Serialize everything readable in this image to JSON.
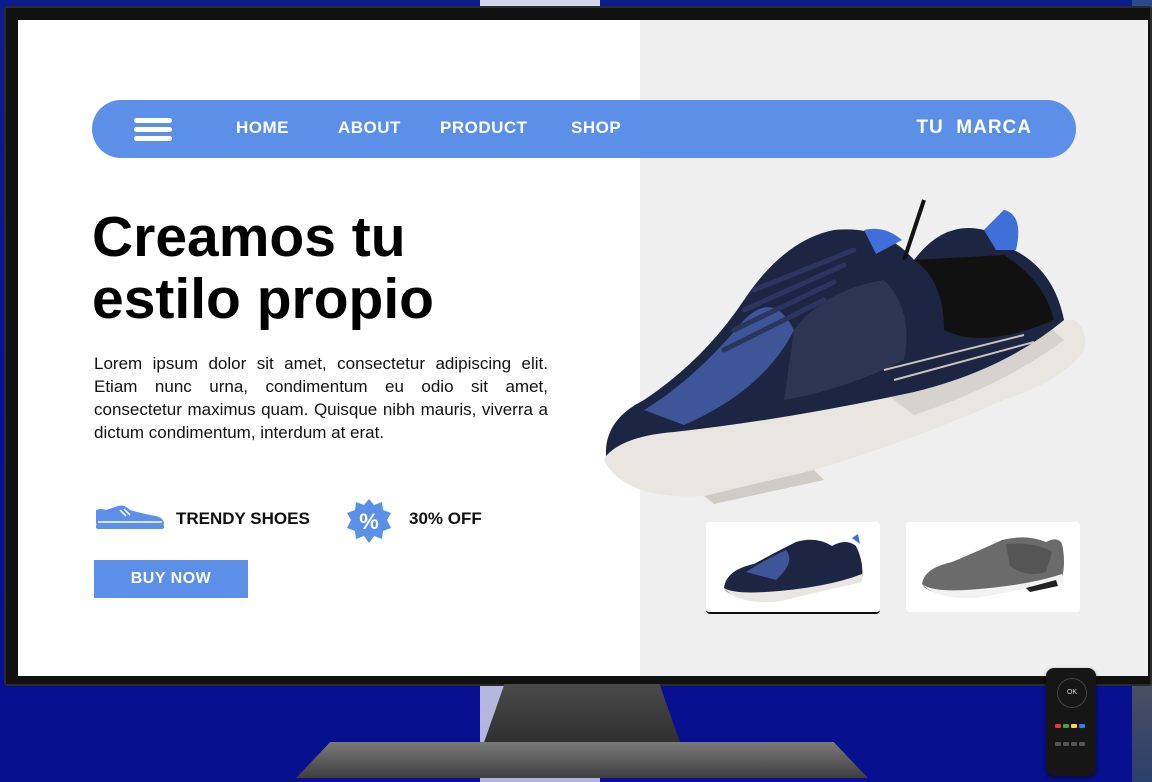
{
  "nav": {
    "items": [
      "HOME",
      "ABOUT",
      "PRODUCT",
      "SHOP"
    ],
    "brand": "TU  MARCA"
  },
  "hero": {
    "title_line1": "Creamos tu",
    "title_line2": "estilo propio",
    "text": "Lorem ipsum dolor sit amet, consectetur adipiscing elit. Etiam nunc urna, condimentum eu odio sit amet, consectetur maximus quam. Quisque nibh mauris, viverra a dictum condimentum, interdum at erat."
  },
  "features": {
    "shoe_label": "TRENDY SHOES",
    "discount_label": "30% OFF",
    "discount_icon_text": "%"
  },
  "cta": {
    "buy_label": "BUY NOW"
  },
  "remote": {
    "ok_label": "OK"
  },
  "colors": {
    "accent": "#5b8fe8",
    "screen_right_bg": "#efeff0",
    "backdrop": "#0a0f9a"
  },
  "icons": [
    "hamburger-menu-icon",
    "sneaker-icon",
    "percent-badge-icon"
  ]
}
